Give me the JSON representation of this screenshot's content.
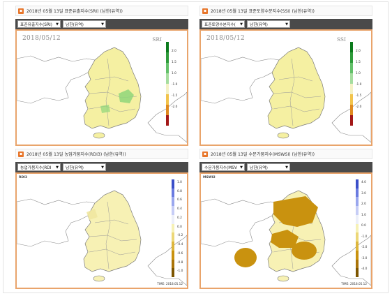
{
  "panels": [
    {
      "title": "2018년 05월 13일 표준유출지수(SRI) (남한(유역))",
      "select1": "표준유출지수(SRI)",
      "select2": "남한(유역)",
      "date": "2018/05/12",
      "tag": "SRI",
      "legend": [
        "2.0",
        "1.5",
        "1.0",
        "-1.0",
        "-1.5",
        "-2.0"
      ],
      "colors": {
        "base": "#f5f0a2",
        "wet": "#8fd67a",
        "dry": "#e2b03a"
      }
    },
    {
      "title": "2018년 05월 13일 표준토양수분지수(SSI) (남한(유역))",
      "select1": "표준토양수분지수(",
      "select2": "남한(유역)",
      "date": "2018/05/12",
      "tag": "SSI",
      "legend": [
        "2.0",
        "1.5",
        "1.0",
        "-1.0",
        "-1.5",
        "-2.0"
      ],
      "colors": {
        "base": "#f5f0a2",
        "wet": "#8fd67a",
        "dry": "#e2b03a"
      }
    },
    {
      "title": "2018년 05월 13일 농업가뭄지수(RDI3) (남한(유역))",
      "select1": "농업가뭄지수(RDI",
      "select2": "남한(유역)",
      "tag": "RDI3",
      "time": "TIME: 2018.05.12",
      "legend": [
        "1.0",
        "0.8",
        "0.6",
        "0.4",
        "0.2",
        "0.0",
        "-0.2",
        "-0.4",
        "-0.6",
        "-0.8",
        "-1.0"
      ],
      "colors": {
        "base": "#f7f1b4",
        "dry": "#c9920f"
      }
    },
    {
      "title": "2018년 05월 13일 수문가뭄지수(MSWSI) (남한(유역))",
      "select1": "수문가뭄지수(MSV",
      "select2": "남한(유역)",
      "tag": "MSWSI",
      "time": "TIME: 2018.05.12",
      "legend": [
        "4.0",
        "3.0",
        "2.0",
        "1.0",
        "0.0",
        "-1.0",
        "-2.0",
        "-3.0",
        "-4.0"
      ],
      "colors": {
        "base": "#f7f1b4",
        "dry": "#c9920f"
      }
    }
  ],
  "legend_colors": {
    "green": [
      "#0b7a1c",
      "#2e9b3a",
      "#63c06a",
      "#a6dd9f",
      "#f4f1c5",
      "#f2c34b",
      "#e08a1f",
      "#a31818"
    ],
    "blue": [
      "#3b4fc9",
      "#6a7be0",
      "#9aa7ee",
      "#c6cdf6",
      "#eceff9",
      "#f6f1b6",
      "#ecd777",
      "#ddb63c",
      "#c9920f",
      "#aa7408",
      "#7d5500"
    ]
  }
}
